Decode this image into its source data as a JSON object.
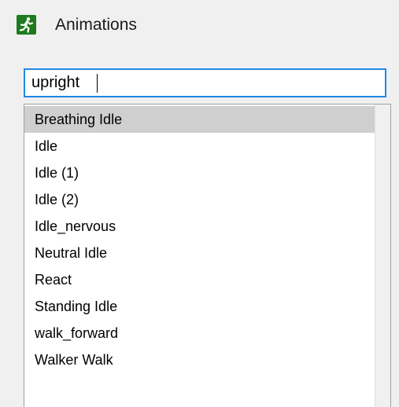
{
  "header": {
    "title": "Animations",
    "icon": "running-man-icon",
    "icon_color": "#1f7a1f"
  },
  "search": {
    "value": "upright",
    "focus_color": "#1e88e5"
  },
  "list": {
    "selected_index": 0,
    "selection_color": "#cfcfcf",
    "items": [
      {
        "label": "Breathing Idle"
      },
      {
        "label": "Idle"
      },
      {
        "label": "Idle (1)"
      },
      {
        "label": "Idle (2)"
      },
      {
        "label": "Idle_nervous"
      },
      {
        "label": "Neutral Idle"
      },
      {
        "label": "React"
      },
      {
        "label": "Standing Idle"
      },
      {
        "label": "walk_forward"
      },
      {
        "label": "Walker Walk"
      }
    ]
  }
}
